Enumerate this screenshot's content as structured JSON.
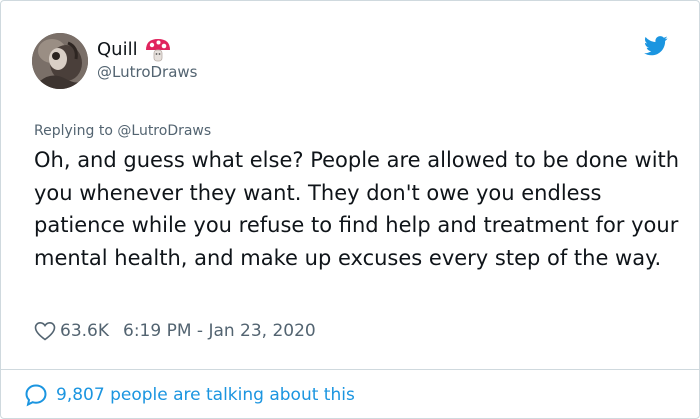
{
  "author": {
    "display_name": "Quill",
    "handle": "@LutroDraws",
    "avatar_icon": "avatar-image",
    "name_emoji": "mushroom-icon"
  },
  "reply": {
    "prefix": "Replying to",
    "handle": "@LutroDraws"
  },
  "tweet": {
    "text": "Oh, and guess what else? People are allowed to be done with you whenever they want. They don't owe you endless patience while you refuse to find help and treatment for your mental health, and make up excuses every step of the way."
  },
  "meta": {
    "likes": "63.6K",
    "timestamp": "6:19 PM - Jan 23, 2020"
  },
  "footer": {
    "talking_text": "9,807 people are talking about this"
  },
  "colors": {
    "twitter_blue": "#1b95e0",
    "text": "#0f1419",
    "secondary_text": "#536471",
    "border": "#cfd9de",
    "mushroom_red": "#e0245e"
  },
  "icons": [
    "avatar-image",
    "mushroom-icon",
    "twitter-bird-icon",
    "heart-icon",
    "speech-bubble-icon"
  ]
}
